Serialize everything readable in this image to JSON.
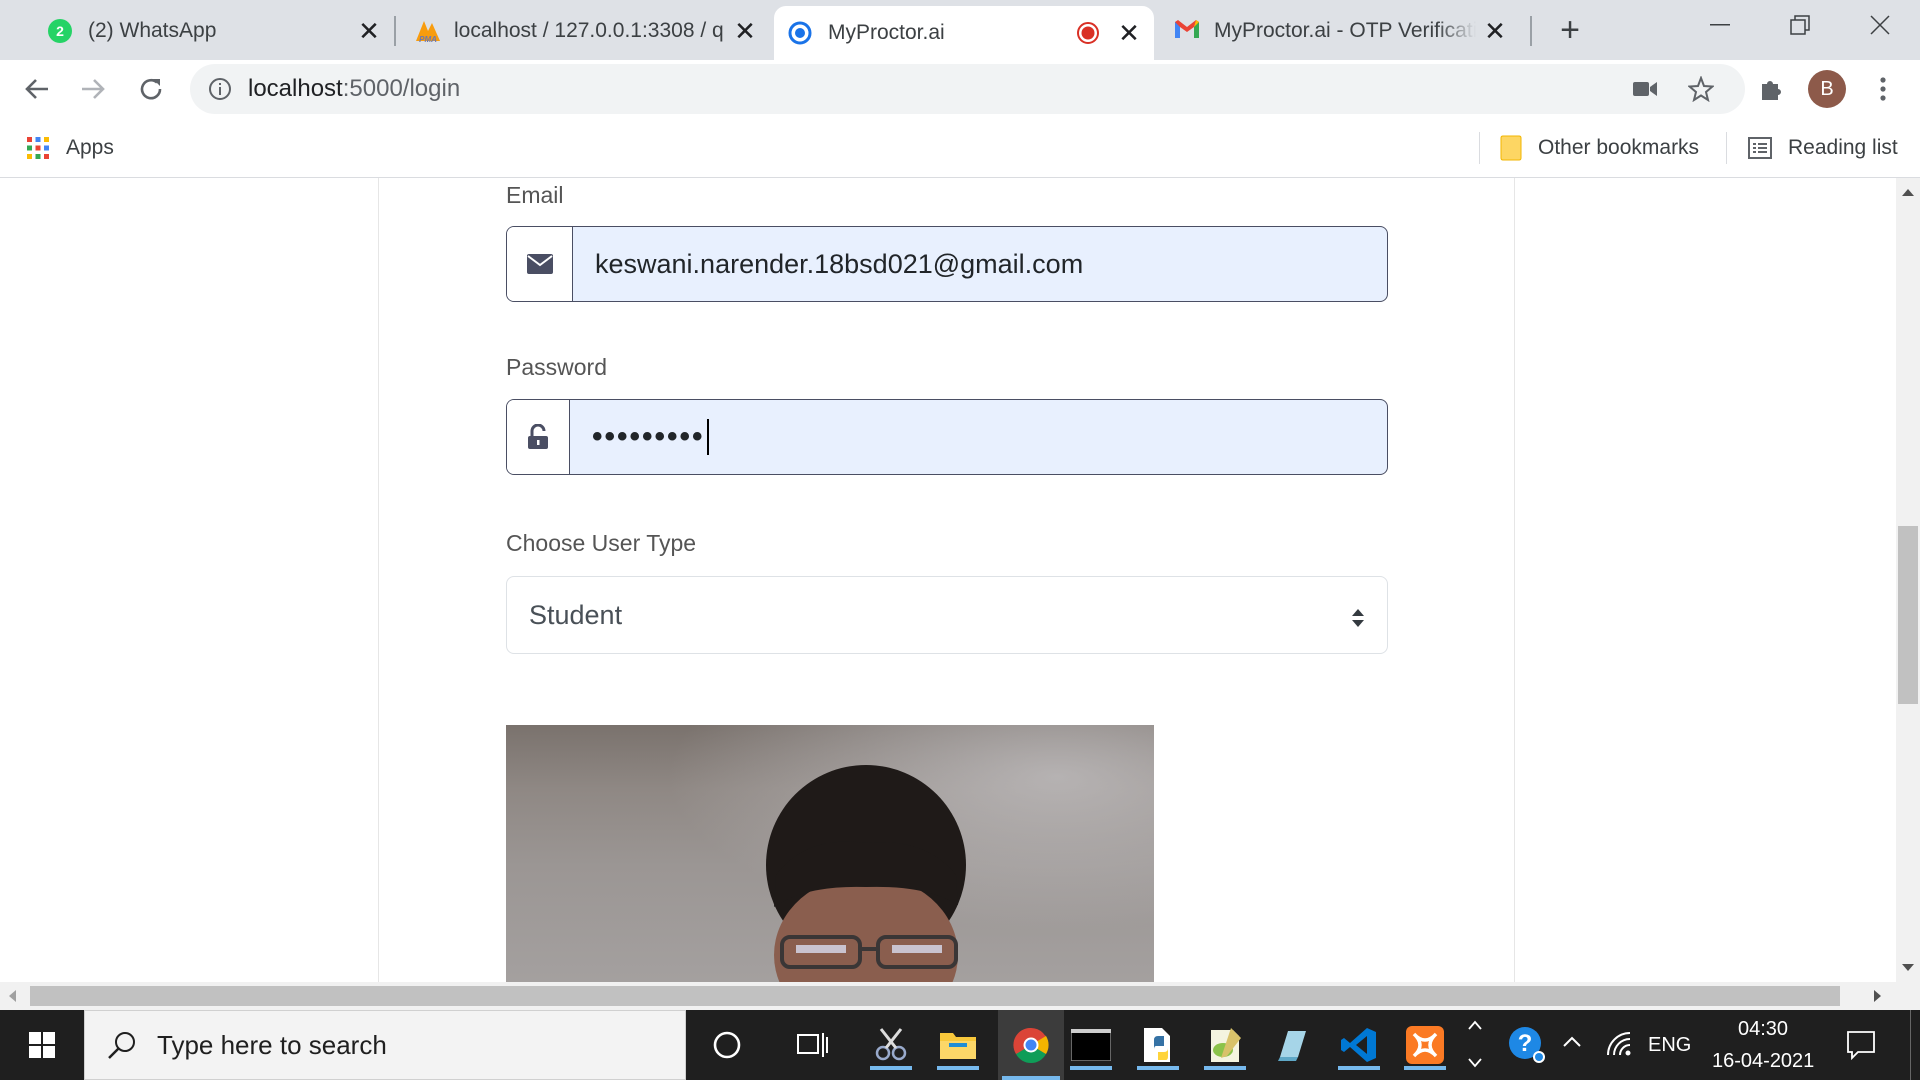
{
  "browser": {
    "tabs": [
      {
        "title": "(2) WhatsApp",
        "badge": "2"
      },
      {
        "title": "localhost / 127.0.0.1:3308 / q",
        "favicon_text": "PMA"
      },
      {
        "title": "MyProctor.ai",
        "active": true
      },
      {
        "title": "MyProctor.ai - OTP Verificatio"
      }
    ],
    "url_host": "localhost",
    "url_path": ":5000/login",
    "profile_initial": "B",
    "bookmarks": {
      "apps": "Apps",
      "other": "Other bookmarks",
      "reading_list": "Reading list"
    }
  },
  "form": {
    "email_label": "Email",
    "email_value": "keswani.narender.18bsd021@gmail.com",
    "password_label": "Password",
    "password_value": "•••••••••",
    "user_type_label": "Choose User Type",
    "user_type_value": "Student"
  },
  "taskbar": {
    "search_placeholder": "Type here to search",
    "language": "ENG",
    "time": "04:30",
    "date": "16-04-2021"
  },
  "colors": {
    "tab_strip": "#dee1e6",
    "autofill_bg": "#e8f0fe",
    "input_border": "#4a4e63",
    "taskbar": "#1f1f1f"
  }
}
